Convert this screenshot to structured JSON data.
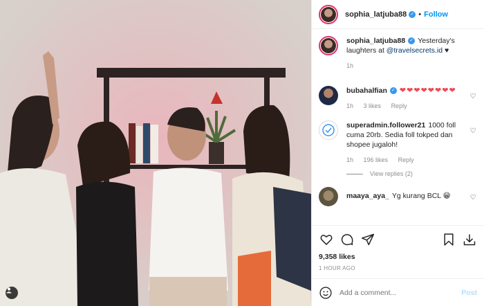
{
  "header": {
    "username": "sophia_latjuba88",
    "separator": "•",
    "follow_label": "Follow"
  },
  "caption": {
    "username": "sophia_latjuba88",
    "text_before": "Yesterday's laughters at ",
    "mention": "@travelsecrets.id",
    "text_after": " ♥",
    "time": "1h"
  },
  "comments": [
    {
      "username": "bubahalfian",
      "text": "❤❤❤❤❤❤❤❤",
      "time": "1h",
      "likes": "3 likes",
      "reply": "Reply"
    },
    {
      "username": "superadmin.follower21",
      "text": "1000 foll cuma 20rb. Sedia foll tokped dan shopee jugaloh!",
      "time": "1h",
      "likes": "196 likes",
      "reply": "Reply"
    },
    {
      "username": "maaya_aya_",
      "text": "Yg kurang BCL 😁"
    }
  ],
  "view_replies": "View replies (2)",
  "actions": {
    "like_icon": "heart-icon",
    "comment_icon": "comment-icon",
    "share_icon": "send-icon",
    "save_icon": "bookmark-icon",
    "download_icon": "download-icon"
  },
  "likes_count": "9,358 likes",
  "timestamp": "1 HOUR AGO",
  "add_comment": {
    "placeholder": "Add a comment...",
    "post_label": "Post"
  },
  "colors": {
    "accent": "#0095f6",
    "heart": "#ed4956",
    "muted": "#8e8e8e",
    "post_disabled": "#b2dffc"
  }
}
